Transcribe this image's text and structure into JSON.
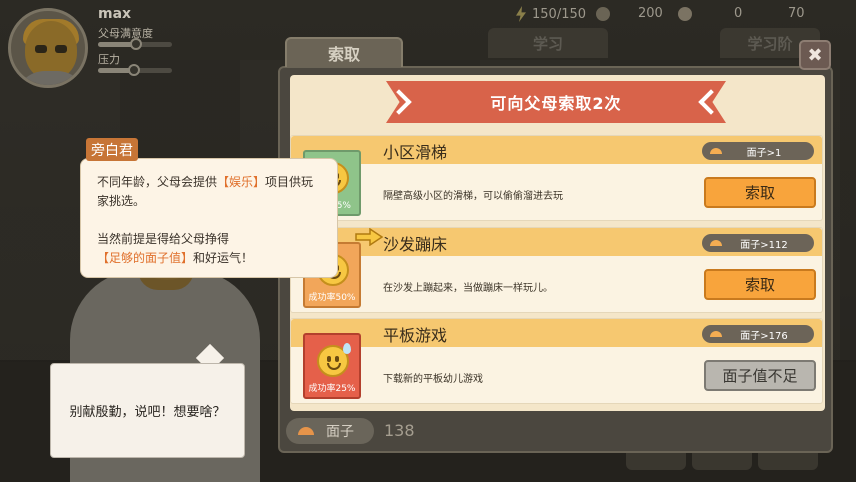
{
  "player": {
    "name": "max",
    "parent_satisfaction_label": "父母满意度",
    "pressure_label": "压力"
  },
  "resources": {
    "energy": "150/150",
    "money": "200",
    "coins": "0",
    "cards": "70"
  },
  "tabs": {
    "active": "索取",
    "study": "学习",
    "study_extra": "学习阶"
  },
  "modal": {
    "banner_title": "可向父母索取2次",
    "close_label": "✖"
  },
  "items": [
    {
      "name": "小区滑梯",
      "requirement": "面子>1",
      "description": "隔壁高级小区的滑梯，可以偷偷溜进去玩",
      "button": "索取",
      "rate": "功率75%"
    },
    {
      "name": "沙发蹦床",
      "requirement": "面子>112",
      "description": "在沙发上蹦起来，当做蹦床一样玩儿。",
      "button": "索取",
      "rate": "成功率50%"
    },
    {
      "name": "平板游戏",
      "requirement": "面子>176",
      "description": "下载新的平板幼儿游戏",
      "button": "面子值不足",
      "rate": "成功率25%"
    }
  ],
  "narrator": {
    "tag": "旁白君",
    "line1_a": "不同年龄，父母会提供",
    "line1_hl": "【娱乐】",
    "line1_b": "项目供玩家挑选。",
    "line2_a": "当然前提是得给父母挣得",
    "line2_hl": "【足够的面子值】",
    "line2_b": "和好运气！"
  },
  "dialog": {
    "text": "别献殷勤，说吧！想要啥？"
  },
  "face": {
    "label": "面子",
    "value": "138"
  },
  "colors": {
    "banner": "#d8634a",
    "item_header": "#f6c870",
    "button_ok": "#f8a43c",
    "button_disabled": "#b9b6af",
    "highlight": "#e0702c"
  },
  "icons": [
    "bolt-icon",
    "money-bag-icon",
    "coin-icon",
    "card-icon",
    "close-icon",
    "face-icon",
    "pointer-arrow-icon",
    "smile-icon"
  ]
}
